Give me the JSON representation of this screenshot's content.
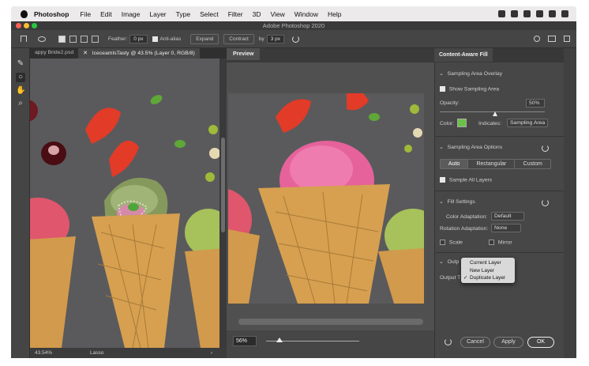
{
  "menubar": {
    "app": "Photoshop",
    "items": [
      "File",
      "Edit",
      "Image",
      "Layer",
      "Type",
      "Select",
      "Filter",
      "3D",
      "View",
      "Window",
      "Help"
    ]
  },
  "window": {
    "title": "Adobe Photoshop 2020"
  },
  "options": {
    "feather_label": "Feather:",
    "feather_value": "0 px",
    "antialias_label": "Anti-alias",
    "expand_label": "Expand",
    "contract_label": "Contract",
    "by_label": "by",
    "by_value": "3 px"
  },
  "tabs": [
    {
      "label": "appy Bride2.psd",
      "active": false
    },
    {
      "label": "IceceamIsTasty @ 43.5% (Layer 0, RGB/8)",
      "active": true
    }
  ],
  "status": {
    "zoom": "43.54%",
    "tool": "Lasso"
  },
  "preview": {
    "tab": "Preview",
    "zoom": "56%"
  },
  "panel": {
    "title": "Content-Aware Fill",
    "overlay": {
      "header": "Sampling Area Overlay",
      "show_label": "Show Sampling Area",
      "opacity_label": "Opacity:",
      "opacity_value": "50%",
      "color_label": "Color:",
      "color_value": "#6cc04a",
      "indicates_label": "Indicates:",
      "indicates_value": "Sampling Area"
    },
    "options": {
      "header": "Sampling Area Options",
      "modes": [
        "Auto",
        "Rectangular",
        "Custom"
      ],
      "selected_mode": "Auto",
      "sample_all_label": "Sample All Layers"
    },
    "fill": {
      "header": "Fill Settings",
      "color_adapt_label": "Color Adaptation:",
      "color_adapt_value": "Default",
      "rotation_label": "Rotation Adaptation:",
      "rotation_value": "None",
      "scale_label": "Scale",
      "mirror_label": "Mirror"
    },
    "output": {
      "header": "Outp",
      "label": "Output T",
      "menu": [
        "Current Layer",
        "New Layer",
        "Duplicate Layer"
      ],
      "selected": "Duplicate Layer"
    },
    "buttons": {
      "cancel": "Cancel",
      "apply": "Apply",
      "ok": "OK"
    }
  }
}
